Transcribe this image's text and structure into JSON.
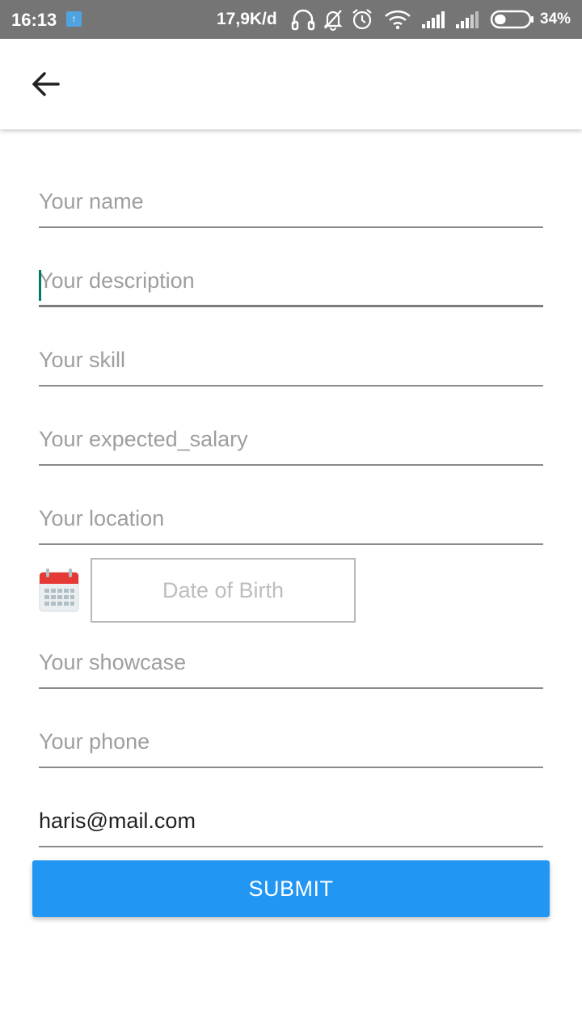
{
  "status_bar": {
    "time": "16:13",
    "network_speed": "17,9K/d",
    "battery_percent": "34%",
    "battery_level": 0.34,
    "icons": [
      "upload-icon",
      "headphones-icon",
      "bell-off-icon",
      "alarm-icon",
      "wifi-icon",
      "signal-icon",
      "signal-icon",
      "battery-icon"
    ]
  },
  "app_bar": {
    "back_icon": "arrow-left-icon"
  },
  "form": {
    "name": {
      "value": "",
      "placeholder": "Your name"
    },
    "description": {
      "value": "",
      "placeholder": "Your description"
    },
    "skill": {
      "value": "",
      "placeholder": "Your skill"
    },
    "expected_salary": {
      "value": "",
      "placeholder": "Your expected_salary"
    },
    "location": {
      "value": "",
      "placeholder": "Your location"
    },
    "date_of_birth": {
      "label": "Date of Birth",
      "icon": "calendar-icon"
    },
    "showcase": {
      "value": "",
      "placeholder": "Your showcase"
    },
    "phone": {
      "value": "",
      "placeholder": "Your phone"
    },
    "email": {
      "value": "haris@mail.com",
      "placeholder": ""
    },
    "submit_label": "SUBMIT"
  },
  "colors": {
    "status_bar": "#757575",
    "accent": "#2196f3",
    "caret": "#00796b",
    "calendar_header": "#e53935"
  }
}
